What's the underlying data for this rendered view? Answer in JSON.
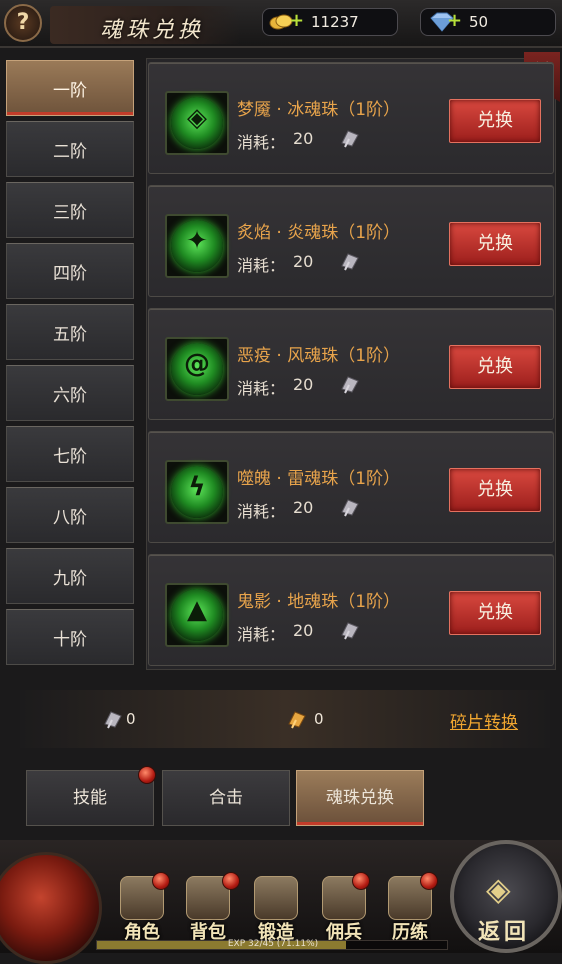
{
  "header": {
    "help_icon": "?",
    "title": "魂珠兑换",
    "gold": {
      "icon": "gold-coins-icon",
      "value": "11237"
    },
    "gems": {
      "icon": "diamond-icon",
      "value": "50"
    }
  },
  "tiers": [
    "一阶",
    "二阶",
    "三阶",
    "四阶",
    "五阶",
    "六阶",
    "七阶",
    "八阶",
    "九阶",
    "十阶"
  ],
  "active_tier_index": 0,
  "items": [
    {
      "name": "梦魇 · 冰魂珠（1阶）",
      "cost_label": "消耗：",
      "cost": "20",
      "button": "兑换",
      "icon": "ice-soul-orb-icon"
    },
    {
      "name": "炙焰 · 炎魂珠（1阶）",
      "cost_label": "消耗：",
      "cost": "20",
      "button": "兑换",
      "icon": "flame-soul-orb-icon"
    },
    {
      "name": "恶疫 · 风魂珠（1阶）",
      "cost_label": "消耗：",
      "cost": "20",
      "button": "兑换",
      "icon": "wind-soul-orb-icon"
    },
    {
      "name": "噬魄 · 雷魂珠（1阶）",
      "cost_label": "消耗：",
      "cost": "20",
      "button": "兑换",
      "icon": "thunder-soul-orb-icon"
    },
    {
      "name": "鬼影 · 地魂珠（1阶）",
      "cost_label": "消耗：",
      "cost": "20",
      "button": "兑换",
      "icon": "earth-soul-orb-icon"
    }
  ],
  "fragments": {
    "silver_count": "0",
    "gold_count": "0",
    "convert_link": "碎片转换"
  },
  "bottom_tabs": [
    {
      "label": "技能",
      "notification": true
    },
    {
      "label": "合击",
      "notification": false
    },
    {
      "label": "魂珠兑换",
      "notification": false
    }
  ],
  "active_bottom_tab_index": 2,
  "nav": {
    "items": [
      {
        "label": "角色",
        "notification": true
      },
      {
        "label": "背包",
        "notification": true
      },
      {
        "label": "锻造",
        "notification": false
      },
      {
        "label": "佣兵",
        "notification": true
      },
      {
        "label": "历练",
        "notification": true
      }
    ],
    "exp_text": "EXP 32/45 (71.11%)",
    "exp_fraction": 0.7111,
    "return_label": "返回"
  },
  "colors": {
    "item_name": "#e7a34b",
    "exchange_button": "#c0352e",
    "active_tab": "#8a6a4a",
    "link": "#f0a630"
  }
}
